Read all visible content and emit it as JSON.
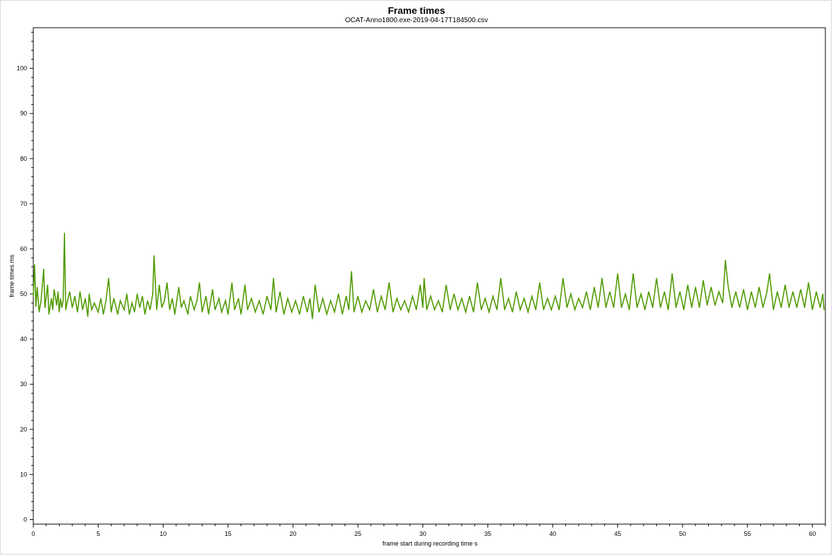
{
  "chart_data": {
    "type": "line",
    "title": "Frame times",
    "subtitle": "OCAT-Anno1800.exe-2019-04-17T184500.csv",
    "xlabel": "frame start during recording time s",
    "ylabel": "frame times ms",
    "xlim": [
      0,
      61
    ],
    "ylim": [
      -1,
      109
    ],
    "x_ticks": [
      0,
      5,
      10,
      15,
      20,
      25,
      30,
      35,
      40,
      45,
      50,
      55,
      60
    ],
    "y_ticks": [
      0,
      10,
      20,
      30,
      40,
      50,
      60,
      70,
      80,
      90,
      100
    ],
    "grid": false,
    "series": [
      {
        "color": "#4f9a00",
        "points": [
          [
            0.0,
            49.5
          ],
          [
            0.1,
            56.5
          ],
          [
            0.2,
            47.2
          ],
          [
            0.3,
            51.5
          ],
          [
            0.45,
            46.0
          ],
          [
            0.6,
            48.5
          ],
          [
            0.8,
            55.5
          ],
          [
            0.9,
            47.0
          ],
          [
            1.1,
            52.0
          ],
          [
            1.2,
            45.5
          ],
          [
            1.4,
            49.0
          ],
          [
            1.5,
            46.5
          ],
          [
            1.6,
            51.0
          ],
          [
            1.8,
            47.5
          ],
          [
            1.9,
            50.5
          ],
          [
            2.0,
            46.0
          ],
          [
            2.1,
            49.0
          ],
          [
            2.2,
            47.0
          ],
          [
            2.3,
            48.5
          ],
          [
            2.4,
            63.5
          ],
          [
            2.5,
            46.5
          ],
          [
            2.6,
            48.0
          ],
          [
            2.8,
            50.5
          ],
          [
            3.0,
            47.0
          ],
          [
            3.2,
            49.5
          ],
          [
            3.4,
            46.0
          ],
          [
            3.6,
            50.5
          ],
          [
            3.8,
            46.5
          ],
          [
            4.0,
            49.0
          ],
          [
            4.2,
            45.0
          ],
          [
            4.3,
            50.0
          ],
          [
            4.5,
            46.5
          ],
          [
            4.7,
            48.0
          ],
          [
            5.0,
            46.0
          ],
          [
            5.2,
            49.0
          ],
          [
            5.4,
            45.5
          ],
          [
            5.6,
            48.5
          ],
          [
            5.8,
            53.5
          ],
          [
            6.0,
            46.0
          ],
          [
            6.2,
            49.0
          ],
          [
            6.5,
            45.5
          ],
          [
            6.7,
            48.5
          ],
          [
            7.0,
            46.5
          ],
          [
            7.2,
            50.0
          ],
          [
            7.4,
            45.5
          ],
          [
            7.6,
            48.0
          ],
          [
            7.8,
            46.0
          ],
          [
            8.0,
            50.0
          ],
          [
            8.2,
            47.0
          ],
          [
            8.4,
            49.5
          ],
          [
            8.6,
            45.5
          ],
          [
            8.8,
            48.5
          ],
          [
            9.0,
            46.5
          ],
          [
            9.2,
            50.0
          ],
          [
            9.3,
            58.5
          ],
          [
            9.5,
            46.5
          ],
          [
            9.7,
            52.0
          ],
          [
            9.9,
            47.0
          ],
          [
            10.1,
            48.5
          ],
          [
            10.3,
            52.5
          ],
          [
            10.5,
            46.5
          ],
          [
            10.7,
            49.0
          ],
          [
            10.9,
            45.5
          ],
          [
            11.2,
            51.5
          ],
          [
            11.4,
            47.0
          ],
          [
            11.6,
            48.5
          ],
          [
            11.9,
            45.5
          ],
          [
            12.1,
            49.5
          ],
          [
            12.4,
            46.5
          ],
          [
            12.6,
            48.5
          ],
          [
            12.8,
            52.5
          ],
          [
            13.0,
            46.0
          ],
          [
            13.3,
            49.5
          ],
          [
            13.5,
            45.5
          ],
          [
            13.8,
            51.0
          ],
          [
            14.0,
            46.5
          ],
          [
            14.3,
            49.0
          ],
          [
            14.5,
            46.0
          ],
          [
            14.8,
            48.5
          ],
          [
            15.0,
            45.5
          ],
          [
            15.3,
            52.5
          ],
          [
            15.5,
            46.5
          ],
          [
            15.8,
            49.0
          ],
          [
            16.0,
            45.5
          ],
          [
            16.3,
            52.0
          ],
          [
            16.5,
            46.5
          ],
          [
            16.8,
            49.0
          ],
          [
            17.1,
            46.0
          ],
          [
            17.4,
            48.5
          ],
          [
            17.7,
            45.5
          ],
          [
            18.0,
            49.5
          ],
          [
            18.3,
            46.5
          ],
          [
            18.5,
            53.5
          ],
          [
            18.7,
            46.0
          ],
          [
            19.0,
            50.5
          ],
          [
            19.3,
            45.5
          ],
          [
            19.6,
            49.0
          ],
          [
            19.9,
            46.0
          ],
          [
            20.2,
            48.5
          ],
          [
            20.5,
            45.5
          ],
          [
            20.8,
            49.5
          ],
          [
            21.1,
            46.0
          ],
          [
            21.3,
            49.0
          ],
          [
            21.5,
            44.5
          ],
          [
            21.7,
            52.0
          ],
          [
            22.0,
            46.0
          ],
          [
            22.3,
            49.0
          ],
          [
            22.6,
            45.5
          ],
          [
            22.9,
            48.5
          ],
          [
            23.2,
            46.0
          ],
          [
            23.5,
            50.0
          ],
          [
            23.8,
            45.5
          ],
          [
            24.1,
            49.5
          ],
          [
            24.3,
            46.5
          ],
          [
            24.5,
            55.0
          ],
          [
            24.7,
            46.0
          ],
          [
            25.0,
            49.5
          ],
          [
            25.3,
            46.0
          ],
          [
            25.6,
            48.5
          ],
          [
            25.9,
            46.5
          ],
          [
            26.2,
            51.0
          ],
          [
            26.5,
            46.0
          ],
          [
            26.8,
            49.5
          ],
          [
            27.1,
            46.5
          ],
          [
            27.4,
            52.5
          ],
          [
            27.7,
            46.0
          ],
          [
            28.0,
            49.0
          ],
          [
            28.3,
            46.5
          ],
          [
            28.6,
            48.5
          ],
          [
            28.9,
            46.0
          ],
          [
            29.2,
            49.5
          ],
          [
            29.5,
            46.5
          ],
          [
            29.8,
            52.0
          ],
          [
            30.0,
            47.0
          ],
          [
            30.1,
            53.5
          ],
          [
            30.3,
            46.5
          ],
          [
            30.6,
            49.5
          ],
          [
            30.9,
            46.5
          ],
          [
            31.2,
            48.5
          ],
          [
            31.5,
            46.0
          ],
          [
            31.8,
            52.0
          ],
          [
            32.1,
            46.5
          ],
          [
            32.4,
            50.0
          ],
          [
            32.7,
            46.5
          ],
          [
            33.0,
            49.0
          ],
          [
            33.3,
            46.0
          ],
          [
            33.6,
            49.5
          ],
          [
            33.9,
            46.0
          ],
          [
            34.2,
            52.5
          ],
          [
            34.5,
            46.5
          ],
          [
            34.8,
            49.0
          ],
          [
            35.1,
            46.0
          ],
          [
            35.4,
            49.5
          ],
          [
            35.7,
            46.5
          ],
          [
            36.0,
            53.5
          ],
          [
            36.3,
            46.5
          ],
          [
            36.6,
            49.0
          ],
          [
            36.9,
            46.0
          ],
          [
            37.2,
            50.5
          ],
          [
            37.5,
            46.5
          ],
          [
            37.8,
            49.0
          ],
          [
            38.1,
            46.0
          ],
          [
            38.4,
            49.5
          ],
          [
            38.7,
            46.5
          ],
          [
            39.0,
            52.5
          ],
          [
            39.3,
            46.5
          ],
          [
            39.6,
            49.0
          ],
          [
            39.9,
            46.5
          ],
          [
            40.2,
            49.5
          ],
          [
            40.5,
            46.5
          ],
          [
            40.8,
            53.5
          ],
          [
            41.1,
            47.0
          ],
          [
            41.4,
            50.0
          ],
          [
            41.7,
            46.5
          ],
          [
            42.0,
            49.0
          ],
          [
            42.3,
            47.0
          ],
          [
            42.6,
            50.5
          ],
          [
            42.9,
            46.5
          ],
          [
            43.2,
            51.5
          ],
          [
            43.5,
            47.0
          ],
          [
            43.8,
            53.5
          ],
          [
            44.1,
            47.0
          ],
          [
            44.4,
            50.5
          ],
          [
            44.7,
            47.0
          ],
          [
            45.0,
            54.5
          ],
          [
            45.3,
            47.0
          ],
          [
            45.6,
            50.0
          ],
          [
            45.9,
            46.5
          ],
          [
            46.2,
            54.5
          ],
          [
            46.5,
            47.0
          ],
          [
            46.8,
            50.0
          ],
          [
            47.1,
            46.5
          ],
          [
            47.4,
            50.5
          ],
          [
            47.7,
            47.0
          ],
          [
            48.0,
            53.5
          ],
          [
            48.3,
            47.0
          ],
          [
            48.6,
            50.5
          ],
          [
            48.9,
            46.5
          ],
          [
            49.2,
            54.5
          ],
          [
            49.5,
            47.0
          ],
          [
            49.8,
            50.5
          ],
          [
            50.1,
            46.5
          ],
          [
            50.4,
            52.0
          ],
          [
            50.7,
            47.0
          ],
          [
            51.0,
            51.5
          ],
          [
            51.3,
            47.0
          ],
          [
            51.6,
            53.0
          ],
          [
            51.9,
            47.5
          ],
          [
            52.2,
            51.5
          ],
          [
            52.5,
            47.5
          ],
          [
            52.8,
            50.5
          ],
          [
            53.1,
            48.0
          ],
          [
            53.3,
            57.5
          ],
          [
            53.5,
            52.0
          ],
          [
            53.8,
            47.0
          ],
          [
            54.1,
            50.5
          ],
          [
            54.4,
            47.0
          ],
          [
            54.7,
            51.0
          ],
          [
            55.0,
            46.5
          ],
          [
            55.3,
            50.5
          ],
          [
            55.6,
            47.0
          ],
          [
            55.9,
            51.5
          ],
          [
            56.2,
            47.0
          ],
          [
            56.5,
            50.5
          ],
          [
            56.7,
            54.5
          ],
          [
            57.0,
            46.5
          ],
          [
            57.3,
            50.5
          ],
          [
            57.6,
            47.0
          ],
          [
            57.9,
            52.0
          ],
          [
            58.2,
            47.0
          ],
          [
            58.5,
            50.5
          ],
          [
            58.8,
            47.0
          ],
          [
            59.1,
            51.0
          ],
          [
            59.4,
            47.0
          ],
          [
            59.7,
            52.5
          ],
          [
            60.0,
            46.5
          ],
          [
            60.3,
            50.5
          ],
          [
            60.6,
            47.0
          ],
          [
            60.8,
            50.0
          ],
          [
            60.9,
            46.5
          ]
        ]
      }
    ]
  }
}
